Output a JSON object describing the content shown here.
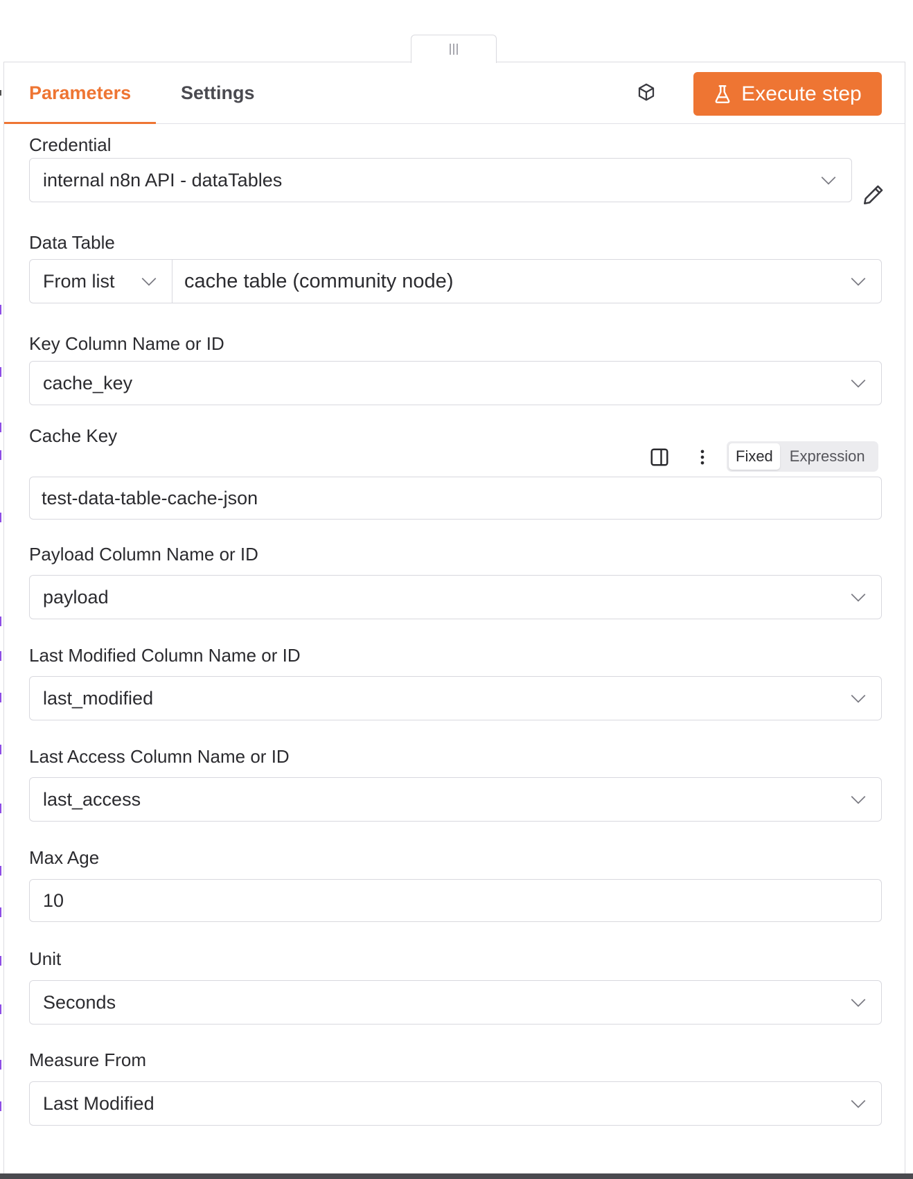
{
  "tabs": {
    "parameters": "Parameters",
    "settings": "Settings"
  },
  "header": {
    "execute_label": "Execute step",
    "accent_color": "#ee7533"
  },
  "fields": {
    "credential": {
      "label": "Credential",
      "value": "internal n8n API - dataTables"
    },
    "data_table": {
      "label": "Data Table",
      "mode": "From list",
      "value": "cache table (community node)"
    },
    "key_column": {
      "label": "Key Column Name or ID",
      "value": "cache_key"
    },
    "cache_key": {
      "label": "Cache Key",
      "value": "test-data-table-cache-json",
      "toggle_fixed": "Fixed",
      "toggle_expression": "Expression",
      "selected_mode": "Fixed"
    },
    "payload_column": {
      "label": "Payload Column Name or ID",
      "value": "payload"
    },
    "last_modified_column": {
      "label": "Last Modified Column Name or ID",
      "value": "last_modified"
    },
    "last_access_column": {
      "label": "Last Access Column Name or ID",
      "value": "last_access"
    },
    "max_age": {
      "label": "Max Age",
      "value": "10"
    },
    "unit": {
      "label": "Unit",
      "value": "Seconds"
    },
    "measure_from": {
      "label": "Measure From",
      "value": "Last Modified"
    }
  },
  "icons": {
    "node_info": "cube-icon",
    "execute": "flask-icon",
    "edit_credential": "pencil-icon",
    "dropdown": "chevron-down-icon",
    "panel": "panel-toggle-icon",
    "more": "kebab-icon",
    "drag": "drag-handle-icon"
  }
}
